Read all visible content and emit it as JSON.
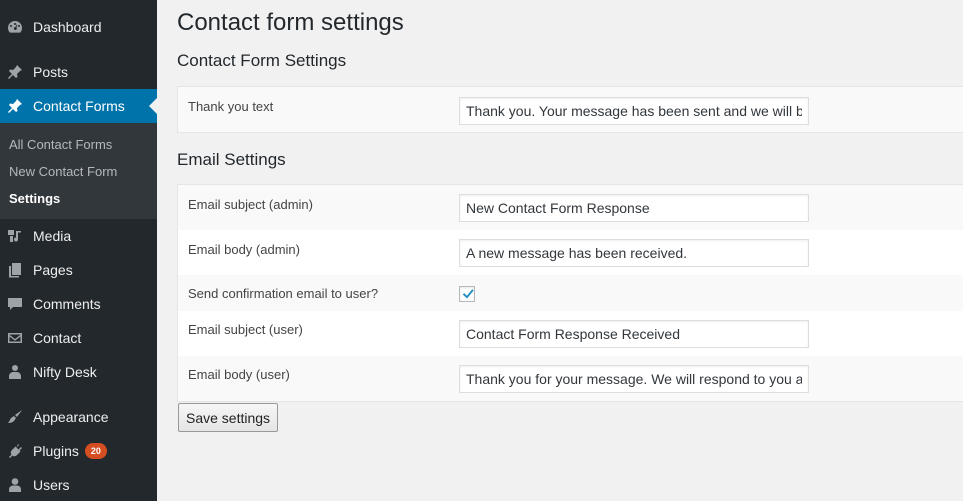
{
  "sidebar": {
    "items": [
      {
        "label": "Dashboard",
        "icon": "dashboard-icon"
      },
      {
        "label": "Posts",
        "icon": "pin-icon"
      },
      {
        "label": "Contact Forms",
        "icon": "pin-icon",
        "active": true
      },
      {
        "label": "Media",
        "icon": "media-icon"
      },
      {
        "label": "Pages",
        "icon": "pages-icon"
      },
      {
        "label": "Comments",
        "icon": "comment-icon"
      },
      {
        "label": "Contact",
        "icon": "envelope-icon"
      },
      {
        "label": "Nifty Desk",
        "icon": "person-tie-icon"
      },
      {
        "label": "Appearance",
        "icon": "paintbrush-icon"
      },
      {
        "label": "Plugins",
        "icon": "plug-icon",
        "badge": "20"
      },
      {
        "label": "Users",
        "icon": "user-icon"
      }
    ],
    "submenu": [
      {
        "label": "All Contact Forms"
      },
      {
        "label": "New Contact Form"
      },
      {
        "label": "Settings",
        "current": true
      }
    ]
  },
  "page": {
    "title": "Contact form settings",
    "section1_title": "Contact Form Settings",
    "section2_title": "Email Settings"
  },
  "form": {
    "thank_you": {
      "label": "Thank you text",
      "value": "Thank you. Your message has been sent and we will be"
    },
    "email_subject_admin": {
      "label": "Email subject (admin)",
      "value": "New Contact Form Response"
    },
    "email_body_admin": {
      "label": "Email body (admin)",
      "value": "A new message has been received."
    },
    "send_confirmation": {
      "label": "Send confirmation email to user?",
      "checked": true
    },
    "email_subject_user": {
      "label": "Email subject (user)",
      "value": "Contact Form Response Received"
    },
    "email_body_user": {
      "label": "Email body (user)",
      "value": "Thank you for your message. We will respond to you as"
    }
  },
  "buttons": {
    "save_label": "Save settings"
  },
  "colors": {
    "sidebar_bg": "#23282d",
    "active_bg": "#0073aa",
    "badge_bg": "#d54e21",
    "check": "#1e8cbe"
  }
}
